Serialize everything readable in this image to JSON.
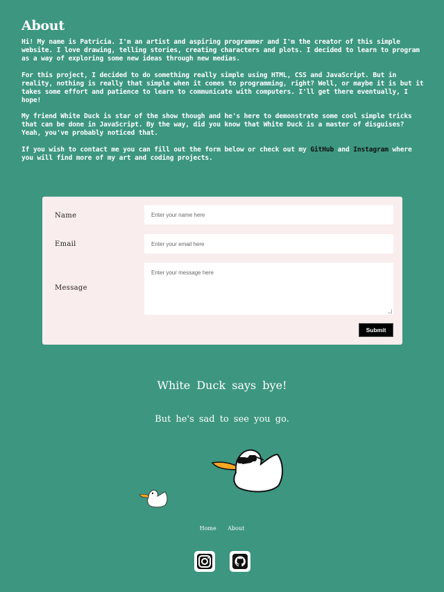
{
  "about": {
    "title": "About",
    "p1": "Hi! My name is Patricia. I'm an artist and aspiring programmer and I'm the creator of this simple website. I love drawing, telling stories, creating characters and plots. I decided to learn to program as a way of exploring some new ideas through new medias.",
    "p2": "For this project, I decided to do something really simple using HTML, CSS and JavaScript. But in reality, nothing is really that simple when it comes to programming, right? Well, or maybe it is but it takes some effort and patience to learn to communicate with computers. I'll get there eventually, I hope!",
    "p3": "My friend White Duck is star of the show though and he's here to demonstrate some cool simple tricks that can be done in JavaScript. By the way, did you know that White Duck is a master of disguises? Yeah, you've probably noticed that.",
    "p4_before": "If you wish to contact me you can fill out the form below or check out my ",
    "github_link": "GitHub",
    "p4_and": " and ",
    "instagram_link": "Instagram",
    "p4_after": " where you will find more of my art and coding projects."
  },
  "form": {
    "name_label": "Name",
    "name_placeholder": "Enter your name here",
    "email_label": "Email",
    "email_placeholder": "Enter your email here",
    "message_label": "Message",
    "message_placeholder": "Enter your message here",
    "submit_label": "Submit"
  },
  "farewell": {
    "title": "White Duck says bye!",
    "subtitle": "But he's sad to see you go."
  },
  "footer": {
    "nav": [
      "Home",
      "About"
    ]
  },
  "icons": {
    "social_1": "instagram-icon",
    "social_2": "github-icon"
  },
  "colors": {
    "background": "#3d9680",
    "form_background": "#f9eded",
    "submit_button": "#000000"
  }
}
